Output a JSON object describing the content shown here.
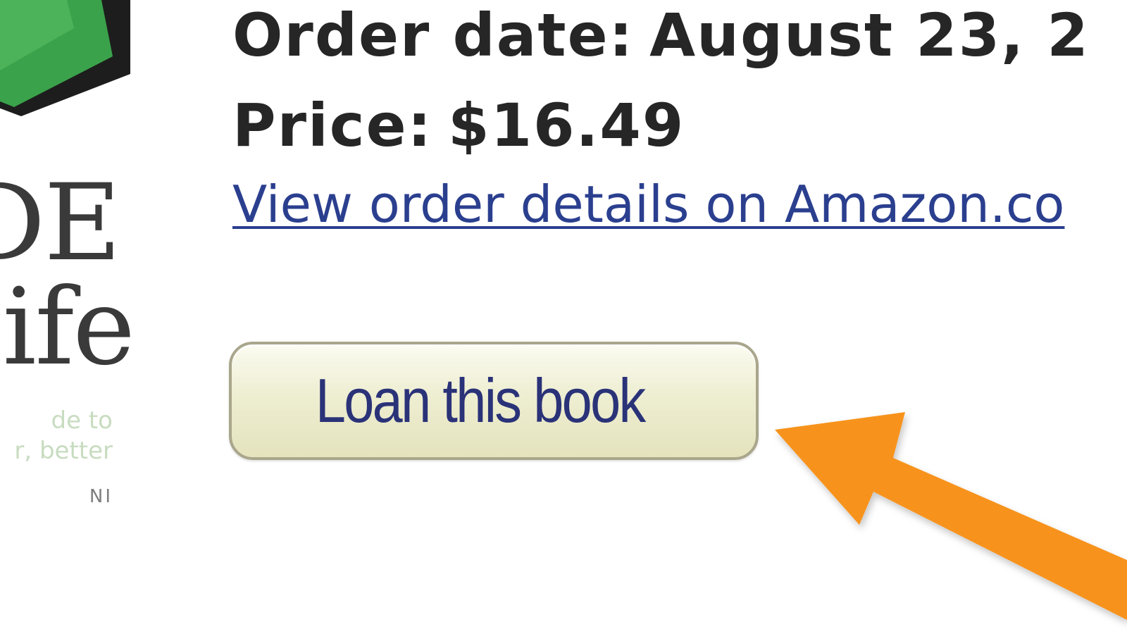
{
  "book_cover": {
    "title_line_1": "DE",
    "title_line_2": "ife",
    "subtitle_line_1": "de to",
    "subtitle_line_2": "r, better",
    "author_fragment": "NI",
    "colors": {
      "cover_green": "#3aa24a",
      "cover_dark": "#1d1d1d"
    }
  },
  "order": {
    "date_label": "Order date:",
    "date_value": "August 23, 2",
    "price_label": "Price:",
    "price_value": "$16.49",
    "details_link": "View order details on Amazon.co"
  },
  "loan_button": {
    "label": "Loan this book"
  },
  "annotation": {
    "arrow_icon": "orange-arrow-pointing-left",
    "arrow_color": "#f7931e"
  },
  "colors": {
    "text": "#262626",
    "link": "#2b3f8f",
    "button_text": "#2a3278",
    "button_border": "#a9a68c"
  }
}
